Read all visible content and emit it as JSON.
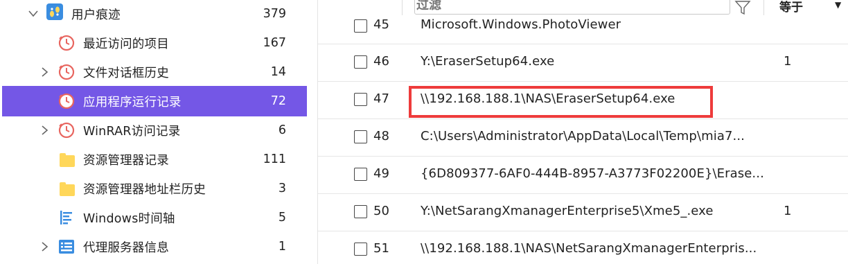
{
  "tree": {
    "items": [
      {
        "label": "用户痕迹",
        "count": "379",
        "icon": "user-traces-icon",
        "expander": "chevron-down",
        "selected": false
      },
      {
        "label": "最近访问的项目",
        "count": "167",
        "icon": "clock-icon",
        "expander": "",
        "selected": false
      },
      {
        "label": "文件对话框历史",
        "count": "14",
        "icon": "clock-icon",
        "expander": "chevron-right",
        "selected": false
      },
      {
        "label": "应用程序运行记录",
        "count": "72",
        "icon": "clock-icon",
        "expander": "",
        "selected": true
      },
      {
        "label": "WinRAR访问记录",
        "count": "6",
        "icon": "clock-icon",
        "expander": "chevron-right",
        "selected": false
      },
      {
        "label": "资源管理器记录",
        "count": "111",
        "icon": "folder-icon",
        "expander": "",
        "selected": false
      },
      {
        "label": "资源管理器地址栏历史",
        "count": "3",
        "icon": "folder-icon",
        "expander": "",
        "selected": false
      },
      {
        "label": "Windows时间轴",
        "count": "5",
        "icon": "timeline-icon",
        "expander": "",
        "selected": false
      },
      {
        "label": "代理服务器信息",
        "count": "1",
        "icon": "list-card-icon",
        "expander": "chevron-right",
        "selected": false
      }
    ]
  },
  "table": {
    "filter_placeholder": "过滤",
    "operator": "等于",
    "rows": [
      {
        "num": "45",
        "path": "Microsoft.Windows.PhotoViewer",
        "value": ""
      },
      {
        "num": "46",
        "path": "Y:\\EraserSetup64.exe",
        "value": "1"
      },
      {
        "num": "47",
        "path": "\\\\192.168.188.1\\NAS\\EraserSetup64.exe",
        "value": ""
      },
      {
        "num": "48",
        "path": "C:\\Users\\Administrator\\AppData\\Local\\Temp\\mia7...",
        "value": ""
      },
      {
        "num": "49",
        "path": "{6D809377-6AF0-444B-8957-A3773F02200E}\\Erase...",
        "value": ""
      },
      {
        "num": "50",
        "path": "Y:\\NetSarangXmanagerEnterprise5\\Xme5_.exe",
        "value": "1"
      },
      {
        "num": "51",
        "path": "\\\\192.168.188.1\\NAS\\NetSarangXmanagerEnterpris...",
        "value": ""
      }
    ]
  },
  "colors": {
    "selected_bg": "#7457e6",
    "highlight_border": "#ee3b3b",
    "clock_icon": "#e8655f",
    "folder_icon": "#ffd75a",
    "blue_icon": "#3a8de0"
  }
}
